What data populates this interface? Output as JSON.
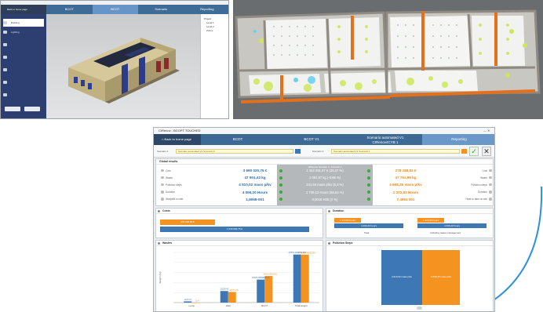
{
  "bim_app": {
    "home_label": "Back to home page",
    "tabs": [
      "BCOT",
      "BCOT",
      "Scenario",
      "Reporting"
    ],
    "active_tab": 1,
    "sidebar": [
      "Building",
      "Lighting",
      "",
      "",
      "",
      "",
      "",
      ""
    ],
    "tree": [
      "Project",
      "Level 1",
      "Level 2",
      "Zones"
    ]
  },
  "report_app": {
    "window_title": "CIRenov - BCOPT TOUCHED",
    "home_label": "Back to home page",
    "tabs": [
      {
        "label": "BCOT"
      },
      {
        "label": "BCOT V1"
      },
      {
        "label": "Scenario automated V1\nCIRenov4CYB 1"
      },
      {
        "label": "Reporting"
      }
    ],
    "active_tab": 3,
    "filter": {
      "label_1": "Scenario 1",
      "value_1": "Scenario automated V1 Scenario 0",
      "label_2": "Scenario 2",
      "value_2": "Scenario automated V1 Scenario 1"
    },
    "global_results": {
      "title": "Global results",
      "header_center": "Difference Scenario 1 / Scenario 2",
      "rows": [
        {
          "label": "Cost",
          "right_label": "Cost",
          "left": "3 690 020,75 €",
          "center": "1 342 081,97 € (35,37 %)",
          "right": "278 418,83 €"
        },
        {
          "label": "Waste",
          "right_label": "Waste",
          "left": "47 901,43 kg",
          "center": "1 081,97 kg (-0,66 %)",
          "right": "47 751,98 kg"
        },
        {
          "label": "Pollution steps",
          "right_label": "Pollution steps",
          "left": "4 910,02 mass p/kv",
          "center": "241,55 mass p/kv (5,3 %)",
          "right": "4 668,25 mass p/kv"
        },
        {
          "label": "Duration",
          "right_label": "Duration",
          "left": "4 096,20 Hours",
          "center": "2 725,12 Hours (66,52 %)",
          "right": "1 372,83 Hours"
        },
        {
          "label": "Wkeptfill on site",
          "right_label": "Heat to take on site",
          "left": "1,8068-001",
          "center": "0,0018 H00 (0 %)",
          "right": "7,4961 001"
        }
      ]
    },
    "costs": {
      "title": "Costs",
      "bar1_label": "278 418,83 €",
      "bar2_label": "1 049 000,75 €"
    },
    "duration": {
      "title": "Duration",
      "left_top": "1 372,83 hours",
      "left_bottom": "4 096,20 hours",
      "left_caption": "Total",
      "right_top": "1 372,83 hours",
      "right_bottom": "4 096,20 hours",
      "right_caption": "Including waste management"
    },
    "wastes": {
      "title": "Wastes",
      "ylabel": "Weight (kg)",
      "categories": [
        "Lamp",
        "Wall",
        "BCOT",
        "Total weight"
      ],
      "data_labels": {
        "blue": [
          "1210,37",
          "11528,49",
          "22925,9984803912",
          "47901,1188931383"
        ],
        "orange": [
          "13,4",
          "10575,75",
          "26514,3842591",
          "47751,9788251383"
        ]
      },
      "max": 50000,
      "colors": {
        "blue": "#3d78b5",
        "orange": "#f59320"
      }
    },
    "pollution": {
      "title": "Pollution Steps",
      "blue_label": "4 910,02 mass p/kv",
      "orange_label": "4 668,25 mass p/kv"
    }
  }
}
